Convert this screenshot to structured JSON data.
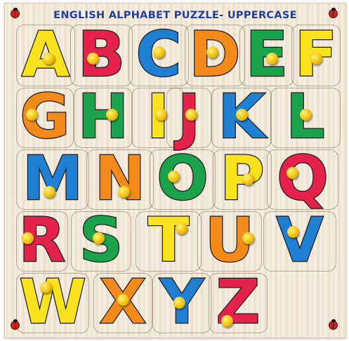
{
  "title": "ENGLISH ALPHABET PUZZLE- UPPERCASE",
  "colors": {
    "yellow": "#fbe21f",
    "red": "#e5224a",
    "blue": "#1f7fd3",
    "orange": "#f48a1a",
    "green": "#1aa34a",
    "outline": "#1c1c1c",
    "knob": "#f2c10a",
    "title": "#1f3f9c"
  },
  "letters": [
    {
      "char": "A",
      "color": "#fbe21f"
    },
    {
      "char": "B",
      "color": "#e5224a"
    },
    {
      "char": "C",
      "color": "#1f7fd3"
    },
    {
      "char": "D",
      "color": "#f48a1a"
    },
    {
      "char": "E",
      "color": "#1aa34a"
    },
    {
      "char": "F",
      "color": "#fbe21f"
    },
    {
      "char": "G",
      "color": "#f48a1a"
    },
    {
      "char": "H",
      "color": "#1aa34a"
    },
    {
      "char": "I",
      "color": "#fbe21f"
    },
    {
      "char": "J",
      "color": "#e5224a"
    },
    {
      "char": "K",
      "color": "#1f7fd3"
    },
    {
      "char": "L",
      "color": "#1aa34a"
    },
    {
      "char": "M",
      "color": "#1f7fd3"
    },
    {
      "char": "N",
      "color": "#f48a1a"
    },
    {
      "char": "O",
      "color": "#1aa34a"
    },
    {
      "char": "P",
      "color": "#fbe21f"
    },
    {
      "char": "Q",
      "color": "#e5224a"
    },
    {
      "char": "R",
      "color": "#e5224a"
    },
    {
      "char": "S",
      "color": "#1aa34a"
    },
    {
      "char": "T",
      "color": "#fbe21f"
    },
    {
      "char": "U",
      "color": "#f48a1a"
    },
    {
      "char": "V",
      "color": "#1f7fd3"
    },
    {
      "char": "W",
      "color": "#fbe21f"
    },
    {
      "char": "X",
      "color": "#f48a1a"
    },
    {
      "char": "Y",
      "color": "#1f7fd3"
    },
    {
      "char": "Z",
      "color": "#e5224a"
    }
  ],
  "icons": [
    "ladybug-icon",
    "ladybug-icon",
    "ladybug-icon",
    "ladybug-icon"
  ]
}
